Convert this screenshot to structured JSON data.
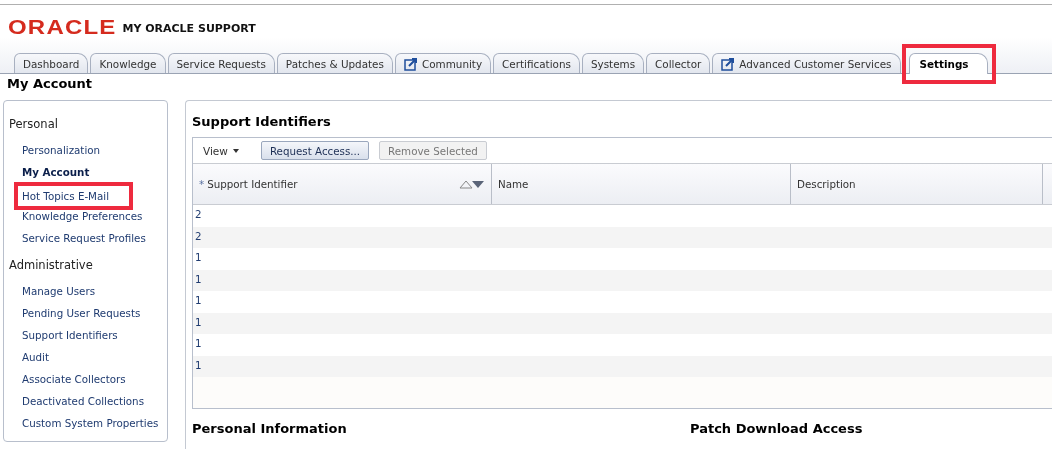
{
  "header": {
    "logo": "ORACLE",
    "product": "MY ORACLE SUPPORT"
  },
  "tabs": [
    {
      "label": "Dashboard",
      "selected": false,
      "external": false,
      "highlighted": false
    },
    {
      "label": "Knowledge",
      "selected": false,
      "external": false,
      "highlighted": false
    },
    {
      "label": "Service Requests",
      "selected": false,
      "external": false,
      "highlighted": false
    },
    {
      "label": "Patches & Updates",
      "selected": false,
      "external": false,
      "highlighted": false
    },
    {
      "label": "Community",
      "selected": false,
      "external": true,
      "highlighted": false
    },
    {
      "label": "Certifications",
      "selected": false,
      "external": false,
      "highlighted": false
    },
    {
      "label": "Systems",
      "selected": false,
      "external": false,
      "highlighted": false
    },
    {
      "label": "Collector",
      "selected": false,
      "external": false,
      "highlighted": false
    },
    {
      "label": "Advanced Customer Services",
      "selected": false,
      "external": true,
      "highlighted": false
    },
    {
      "label": "Settings",
      "selected": true,
      "external": false,
      "highlighted": true
    }
  ],
  "page_title": "My Account",
  "sidebar": {
    "sections": [
      {
        "title": "Personal",
        "items": [
          {
            "label": "Personalization",
            "selected": false,
            "highlighted": false
          },
          {
            "label": "My Account",
            "selected": true,
            "highlighted": false
          },
          {
            "label": "Hot Topics E-Mail",
            "selected": false,
            "highlighted": true
          },
          {
            "label": "Knowledge Preferences",
            "selected": false,
            "highlighted": false
          },
          {
            "label": "Service Request Profiles",
            "selected": false,
            "highlighted": false
          }
        ]
      },
      {
        "title": "Administrative",
        "items": [
          {
            "label": "Manage Users",
            "selected": false,
            "highlighted": false
          },
          {
            "label": "Pending User Requests",
            "selected": false,
            "highlighted": false
          },
          {
            "label": "Support Identifiers",
            "selected": false,
            "highlighted": false
          },
          {
            "label": "Audit",
            "selected": false,
            "highlighted": false
          },
          {
            "label": "Associate Collectors",
            "selected": false,
            "highlighted": false
          },
          {
            "label": "Deactivated Collections",
            "selected": false,
            "highlighted": false
          },
          {
            "label": "Custom System Properties",
            "selected": false,
            "highlighted": false
          }
        ]
      }
    ]
  },
  "support_identifiers": {
    "title": "Support Identifiers",
    "toolbar": [
      {
        "kind": "menu",
        "label": "View"
      },
      {
        "kind": "button",
        "label": "Request Access...",
        "disabled": false
      },
      {
        "kind": "button",
        "label": "Remove Selected",
        "disabled": true
      }
    ],
    "columns": [
      {
        "label": "Support Identifier",
        "marker": "*",
        "sortable": true
      },
      {
        "label": "Name",
        "sortable": false
      },
      {
        "label": "Description",
        "sortable": false
      }
    ],
    "rows": [
      {
        "support_identifier": "2"
      },
      {
        "support_identifier": "2"
      },
      {
        "support_identifier": "1"
      },
      {
        "support_identifier": "1"
      },
      {
        "support_identifier": "1"
      },
      {
        "support_identifier": "1"
      },
      {
        "support_identifier": "1"
      },
      {
        "support_identifier": "1"
      }
    ]
  },
  "sections": [
    "Personal Information",
    "Patch Download Access"
  ]
}
